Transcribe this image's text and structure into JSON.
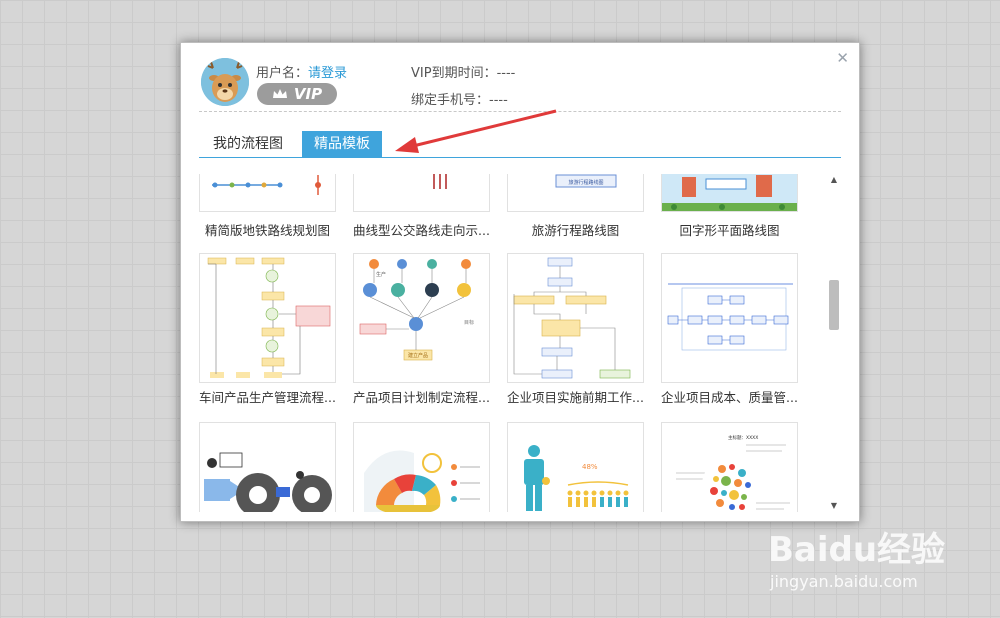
{
  "user": {
    "name_label": "用户名：",
    "login_link": "请登录",
    "vip_badge": "VIP",
    "vip_expiry": "VIP到期时间：----",
    "phone": "绑定手机号：----"
  },
  "tabs": [
    {
      "label": "我的流程图",
      "active": false
    },
    {
      "label": "精品模板",
      "active": true
    }
  ],
  "templates": [
    {
      "title": "精简版地铁路线规划图"
    },
    {
      "title": "曲线型公交路线走向示..."
    },
    {
      "title": "旅游行程路线图"
    },
    {
      "title": "回字形平面路线图"
    },
    {
      "title": "车间产品生产管理流程..."
    },
    {
      "title": "产品项目计划制定流程..."
    },
    {
      "title": "企业项目实施前期工作..."
    },
    {
      "title": "企业项目成本、质量管..."
    },
    {
      "title": ""
    },
    {
      "title": ""
    },
    {
      "title": ""
    },
    {
      "title": ""
    }
  ],
  "thumb_text": {
    "t3": "旅游行程路线图",
    "t6a": "生产",
    "t6b": "建立产品",
    "t6c": "目标",
    "t11": "48%",
    "t12": "主标题：XXXX"
  },
  "colors": {
    "accent": "#3fa4dc",
    "arrow": "#e03a3a"
  },
  "watermark": {
    "logo": "Baidu经验",
    "url": "jingyan.baidu.com"
  }
}
